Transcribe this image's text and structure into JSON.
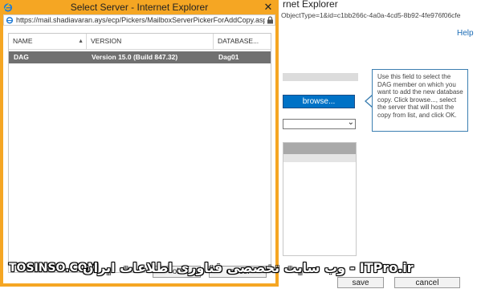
{
  "background_window": {
    "title_fragment": "rnet Explorer",
    "address_fragment": "ObjectType=1&id=c1bb266c-4a0a-4cd5-8b92-4fe976f06cfe",
    "help_link": "Help",
    "browse_button": "browse...",
    "tooltip": "Use this field to select the DAG member on which you want to add the new database copy. Click browse..., select the server that will host the copy from list, and click OK.",
    "save_button": "save",
    "cancel_button": "cancel"
  },
  "dialog": {
    "title": "Select Server - Internet Explorer",
    "address": "https://mail.shadiavaran.ays/ecp/Pickers/MailboxServerPickerForAddCopy.aspx?p",
    "columns": [
      "NAME",
      "VERSION",
      "DATABASE..."
    ],
    "sorted_column_index": 0,
    "rows": [
      {
        "name": "DAG",
        "version": "Version 15.0 (Build 847.32)",
        "database": "Dag01",
        "selected": true
      }
    ],
    "ok_button": "ok",
    "cancel_button": "cancel"
  },
  "watermark": {
    "left": "TOSINSO.COM",
    "right": "ITPro.ir - وب سایت تخصصی فناوری اطلاعات ایران"
  },
  "colors": {
    "dialog_frame": "#f5a623",
    "selected_row": "#707070",
    "primary_button": "#0072c6",
    "link": "#1a6bb5",
    "tooltip_border": "#3c7fb1"
  },
  "icons": {
    "dialog_app_icon": "internet-explorer-icon",
    "address_icon": "internet-explorer-icon",
    "lock": "lock-icon",
    "close": "close-icon",
    "sort": "sort-ascending-icon",
    "dropdown": "chevron-down-icon"
  }
}
